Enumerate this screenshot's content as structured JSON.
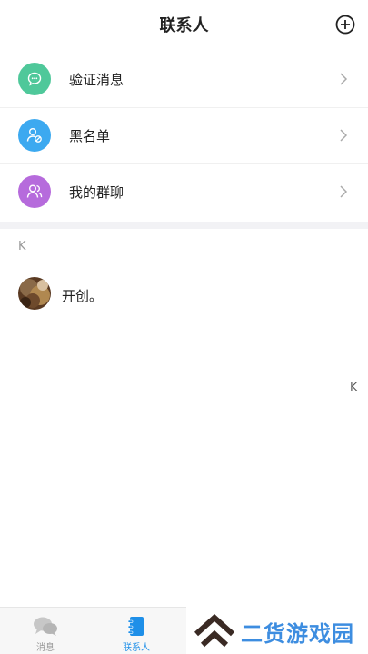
{
  "header": {
    "title": "联系人",
    "add_icon": "plus-circle-icon"
  },
  "menu": [
    {
      "label": "验证消息",
      "icon": "chat-bubble-icon",
      "color": "#4fc89a"
    },
    {
      "label": "黑名单",
      "icon": "user-block-icon",
      "color": "#3ca9f0"
    },
    {
      "label": "我的群聊",
      "icon": "group-icon",
      "color": "#b66bdc"
    }
  ],
  "contacts": {
    "section_letter": "K",
    "items": [
      {
        "name": "开创。"
      }
    ]
  },
  "index_bar": [
    "K"
  ],
  "tabbar": {
    "tabs": [
      {
        "label": "消息",
        "icon": "chat-bubbles-icon",
        "active": false
      },
      {
        "label": "联系人",
        "icon": "contacts-book-icon",
        "active": true
      }
    ],
    "active_color": "#1e8fe8",
    "inactive_color": "#999999"
  },
  "watermark": {
    "text": "二货游戏园"
  }
}
